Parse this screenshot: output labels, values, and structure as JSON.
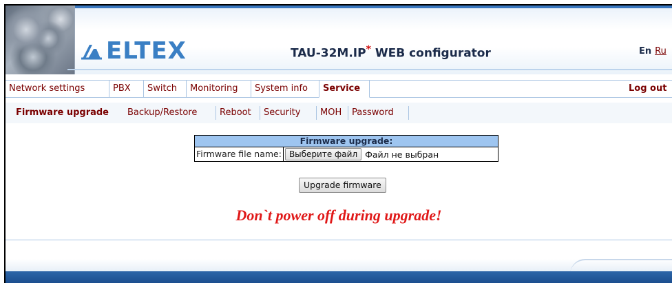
{
  "header": {
    "logo_text": "ELTEX",
    "title": "TAU-32M.IP",
    "title_mark": "*",
    "title_suffix": "WEB configurator",
    "lang_en": "En",
    "lang_ru": "Ru"
  },
  "nav": {
    "items": [
      {
        "label": "Network settings"
      },
      {
        "label": "PBX"
      },
      {
        "label": "Switch"
      },
      {
        "label": "Monitoring"
      },
      {
        "label": "System info"
      },
      {
        "label": "Service"
      }
    ],
    "active": "Service",
    "logout": "Log out"
  },
  "subnav": {
    "items": [
      {
        "label": "Firmware upgrade"
      },
      {
        "label": "Backup/Restore"
      },
      {
        "label": "Reboot"
      },
      {
        "label": "Security"
      },
      {
        "label": "MOH"
      },
      {
        "label": "Password"
      }
    ],
    "active": "Firmware upgrade"
  },
  "firmware": {
    "caption": "Firmware upgrade:",
    "file_label": "Firmware file name:",
    "choose_button": "Выберите файл",
    "file_status": "Файл не выбран",
    "upgrade_button": "Upgrade firmware",
    "warning": "Don`t power off during upgrade!"
  },
  "colors": {
    "accent": "#3a7fc4",
    "link": "#7a0000",
    "warning": "#e01818",
    "table_caption_bg": "#9ec5f0",
    "footer": "#1a4c8c"
  },
  "icons": {
    "logo": "eltex-logo-icon"
  }
}
